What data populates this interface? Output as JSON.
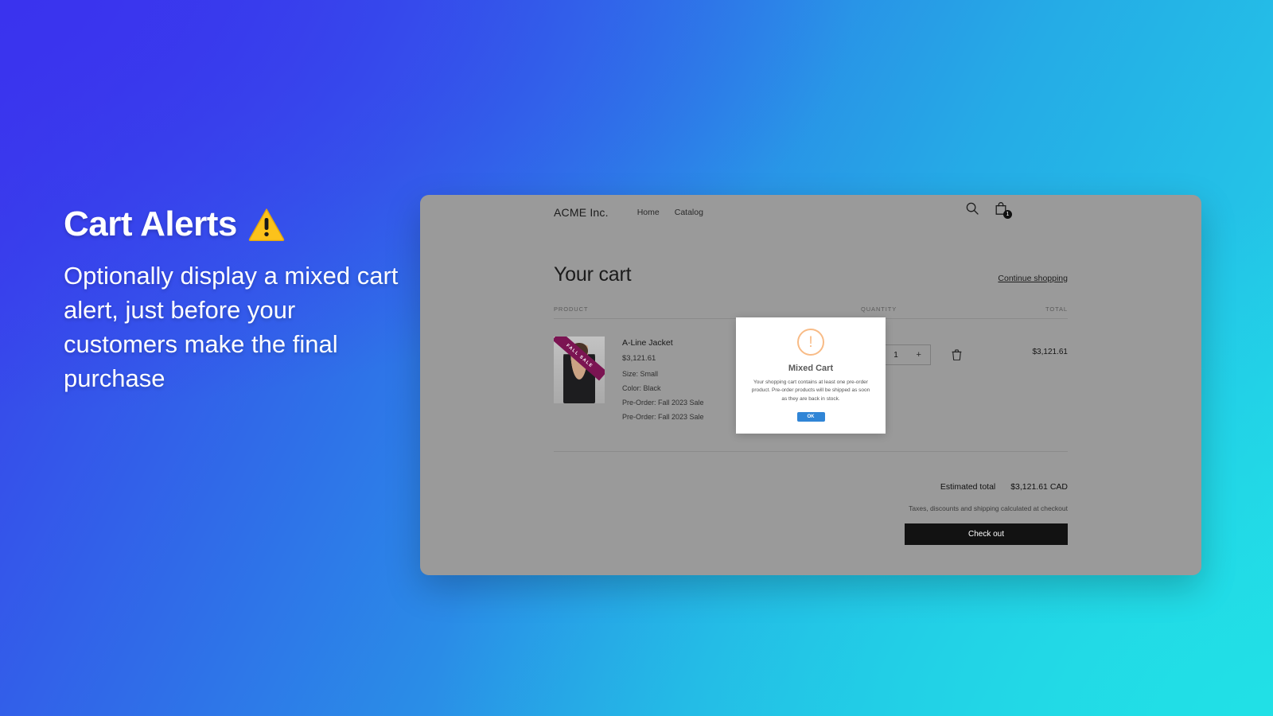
{
  "promo": {
    "title": "Cart Alerts",
    "title_icon": "warning-emoji",
    "subtitle": "Optionally display a mixed cart alert, just before your customers make the final purchase"
  },
  "colors": {
    "gradient_start": "#3b36ec",
    "gradient_mid": "#25abe6",
    "gradient_end": "#22d8e8",
    "modal_ok_button": "#3085d6",
    "modal_icon_border": "#f8bb86",
    "checkout_button": "#121212",
    "sale_ribbon": "#7b1452"
  },
  "store": {
    "brand": "ACME Inc.",
    "nav": [
      {
        "label": "Home"
      },
      {
        "label": "Catalog"
      }
    ],
    "actions": {
      "search_icon": "search-icon",
      "cart_icon": "shopping-bag-icon",
      "cart_count": "1"
    }
  },
  "cart": {
    "title": "Your cart",
    "continue_shopping": "Continue shopping",
    "columns": {
      "product": "PRODUCT",
      "quantity": "QUANTITY",
      "total": "TOTAL"
    },
    "items": [
      {
        "name": "A-Line Jacket",
        "price": "$3,121.61",
        "ribbon": "FALL SALE",
        "meta": [
          "Size: Small",
          "Color: Black",
          "Pre-Order: Fall 2023 Sale",
          "Pre-Order: Fall 2023 Sale"
        ],
        "qty_decrease": "−",
        "qty_value": "1",
        "qty_increase": "+",
        "remove_icon": "trash-icon",
        "line_total": "$3,121.61"
      }
    ],
    "summary": {
      "estimated_total_label": "Estimated total",
      "estimated_total_value": "$3,121.61 CAD",
      "note": "Taxes, discounts and shipping calculated at checkout",
      "checkout_label": "Check out"
    }
  },
  "modal": {
    "icon": "warning-circle-icon",
    "icon_glyph": "!",
    "title": "Mixed Cart",
    "body": "Your shopping cart contains at least one pre-order product. Pre-order products will be shipped as soon as they are back in stock.",
    "ok_label": "OK"
  }
}
